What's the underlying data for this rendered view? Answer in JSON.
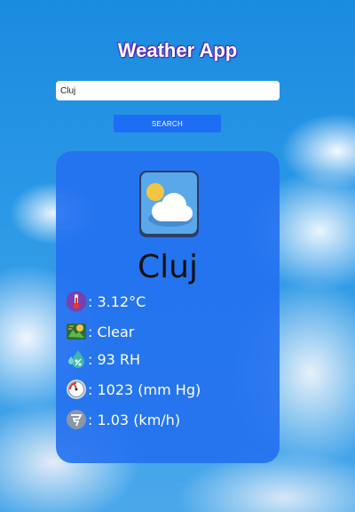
{
  "app": {
    "title": "Weather App"
  },
  "search": {
    "value": "Cluj",
    "button_label": "SEARCH"
  },
  "weather": {
    "city": "Cluj",
    "icon": "partly-cloudy-icon",
    "rows": [
      {
        "icon": "thermometer-icon",
        "text": ": 3.12°C"
      },
      {
        "icon": "weather-condition-icon",
        "text": ": Clear"
      },
      {
        "icon": "humidity-icon",
        "text": ": 93 RH"
      },
      {
        "icon": "pressure-gauge-icon",
        "text": ": 1023 (mm Hg)"
      },
      {
        "icon": "wind-icon",
        "text": ": 1.03 (km/h)"
      }
    ]
  },
  "colors": {
    "card": "#2470f0",
    "button": "#1e6ef5",
    "title_outline": "#5a1aa8"
  }
}
